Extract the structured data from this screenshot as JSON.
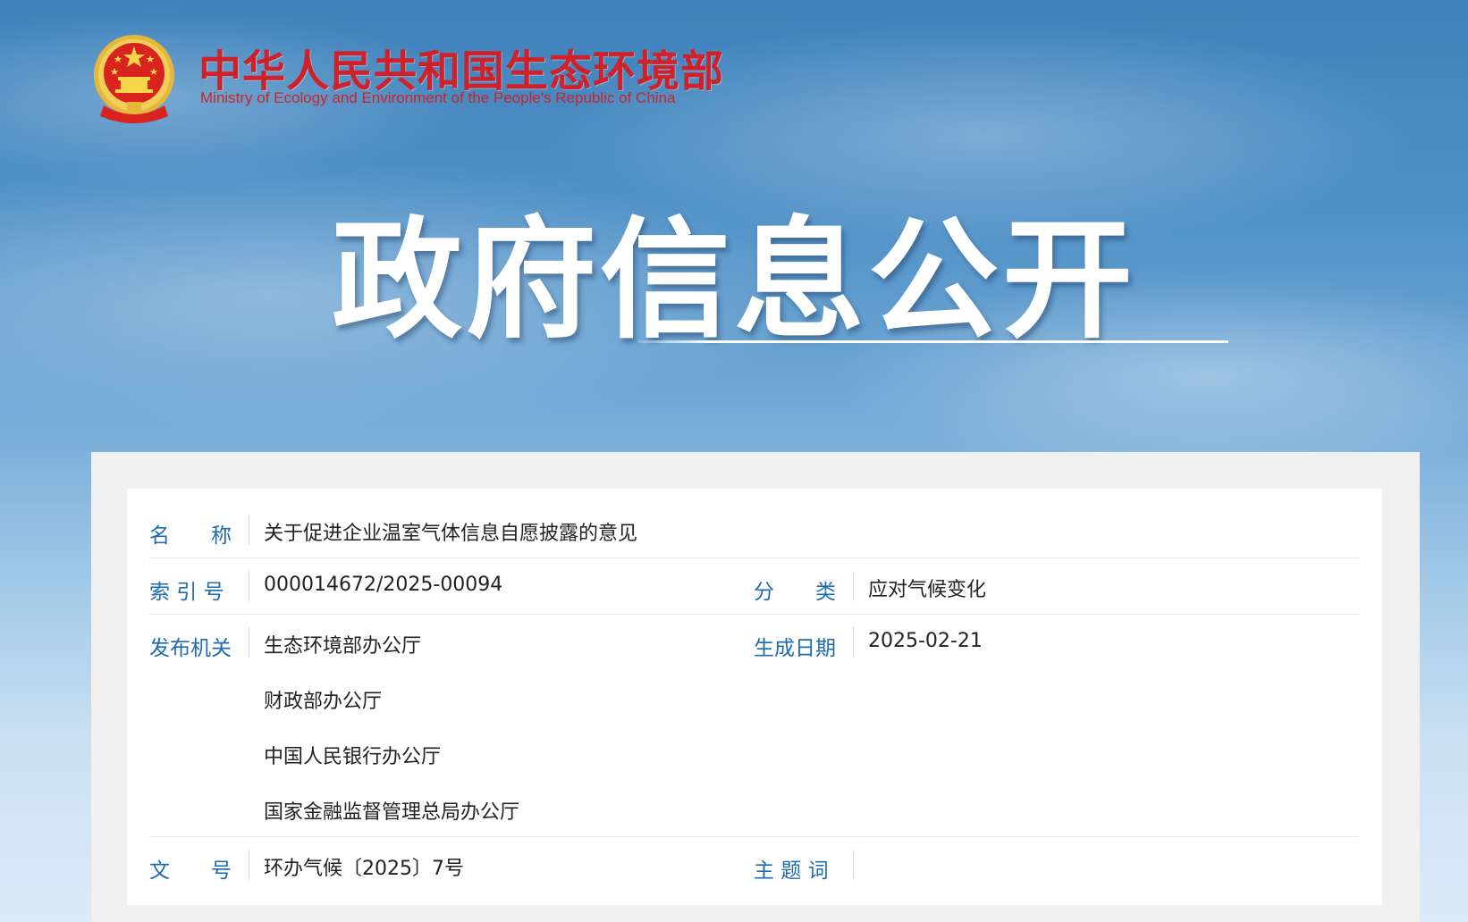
{
  "header": {
    "ministry_name_cn": "中华人民共和国生态环境部",
    "ministry_name_en": "Ministry of Ecology and Environment of the People's Republic of China",
    "emblem_icon": "national-emblem-icon"
  },
  "hero": {
    "title": "政府信息公开"
  },
  "info": {
    "name_label": "名　　称",
    "name_value": "关于促进企业温室气体信息自愿披露的意见",
    "index_label": "索 引 号",
    "index_value": "000014672/2025-00094",
    "category_label": "分　　类",
    "category_value": "应对气候变化",
    "issuer_label": "发布机关",
    "issuers": [
      "生态环境部办公厅",
      "财政部办公厅",
      "中国人民银行办公厅",
      "国家金融监督管理总局办公厅"
    ],
    "date_label": "生成日期",
    "date_value": "2025-02-21",
    "docno_label": "文　　号",
    "docno_value": "环办气候〔2025〕7号",
    "keywords_label": "主 题 词",
    "keywords_value": ""
  },
  "colors": {
    "label_blue": "#1e6bb0",
    "title_red": "#d0202a",
    "text_dark": "#222222"
  }
}
